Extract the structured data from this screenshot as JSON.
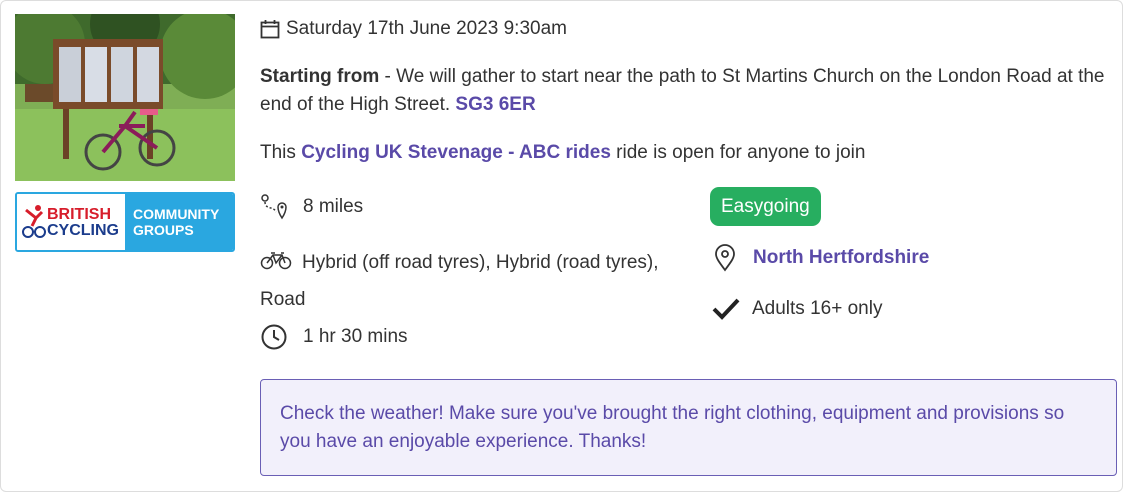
{
  "event": {
    "date_time": "Saturday 17th June 2023 9:30am",
    "starting_from_label": "Starting from",
    "starting_from_text": " - We will gather to start near the path to St Martins Church on the London Road at the end of the High Street. ",
    "postcode": "SG3 6ER",
    "open_prefix": "This ",
    "group_name": "Cycling UK Stevenage - ABC rides",
    "open_suffix": " ride is open for anyone to join",
    "distance": "8 miles",
    "bike_types": "Hybrid (off road tyres), Hybrid (road tyres), Road",
    "duration": "1 hr 30 mins",
    "difficulty": "Easygoing",
    "region": "North Hertfordshire",
    "age_restriction": "Adults 16+ only",
    "notice": "Check the weather! Make sure you've brought the right clothing, equipment and provisions so you have an enjoyable experience. Thanks!"
  },
  "logo": {
    "line1": "BRITISH",
    "line2": "CYCLING",
    "community_line1": "COMMUNITY",
    "community_line2": "GROUPS"
  },
  "icons": {
    "date": "calendar-icon",
    "distance": "route-icon",
    "bike": "bicycle-icon",
    "duration": "clock-icon",
    "region": "map-pin-icon",
    "age": "check-icon"
  },
  "colors": {
    "link": "#5a4aa8",
    "badge": "#27ae60",
    "logo_blue": "#2aa7e0",
    "notice_bg": "#f2f0fb"
  }
}
